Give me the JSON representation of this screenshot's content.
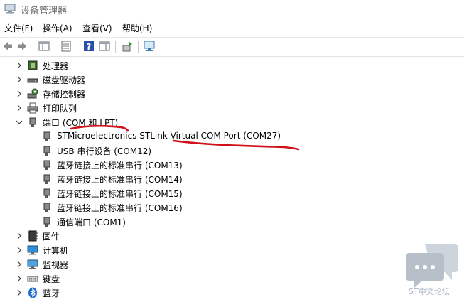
{
  "window": {
    "title": "设备管理器"
  },
  "menu": [
    {
      "label": "文件(F)"
    },
    {
      "label": "操作(A)"
    },
    {
      "label": "查看(V)"
    },
    {
      "label": "帮助(H)"
    }
  ],
  "toolbar": {
    "buttons": [
      {
        "name": "back-icon"
      },
      {
        "name": "forward-icon"
      },
      {
        "name": "show-hide-tree-icon"
      },
      {
        "name": "properties-icon"
      },
      {
        "name": "help-icon"
      },
      {
        "name": "action-pane-icon"
      },
      {
        "name": "update-driver-icon"
      },
      {
        "name": "scan-hardware-icon"
      }
    ]
  },
  "tree": {
    "categories": [
      {
        "label": "处理器",
        "icon": "processor-icon",
        "expanded": false
      },
      {
        "label": "磁盘驱动器",
        "icon": "disk-drive-icon",
        "expanded": false
      },
      {
        "label": "存储控制器",
        "icon": "storage-controller-icon",
        "expanded": false
      },
      {
        "label": "打印队列",
        "icon": "printer-icon",
        "expanded": false
      },
      {
        "label": "端口 (COM 和 LPT)",
        "icon": "port-icon",
        "expanded": true,
        "children": [
          {
            "label": "STMicroelectronics STLink Virtual COM Port (COM27)"
          },
          {
            "label": "USB 串行设备 (COM12)"
          },
          {
            "label": "蓝牙链接上的标准串行 (COM13)"
          },
          {
            "label": "蓝牙链接上的标准串行 (COM14)"
          },
          {
            "label": "蓝牙链接上的标准串行 (COM15)"
          },
          {
            "label": "蓝牙链接上的标准串行 (COM16)"
          },
          {
            "label": "通信端口 (COM1)"
          }
        ]
      },
      {
        "label": "固件",
        "icon": "firmware-icon",
        "expanded": false
      },
      {
        "label": "计算机",
        "icon": "computer-icon",
        "expanded": false
      },
      {
        "label": "监视器",
        "icon": "monitor-icon",
        "expanded": false
      },
      {
        "label": "键盘",
        "icon": "keyboard-icon",
        "expanded": false
      },
      {
        "label": "蓝牙",
        "icon": "bluetooth-icon",
        "expanded": false
      }
    ]
  },
  "annotation": {
    "color": "#d0101a"
  },
  "watermark": {
    "text": "ST中文论坛"
  }
}
